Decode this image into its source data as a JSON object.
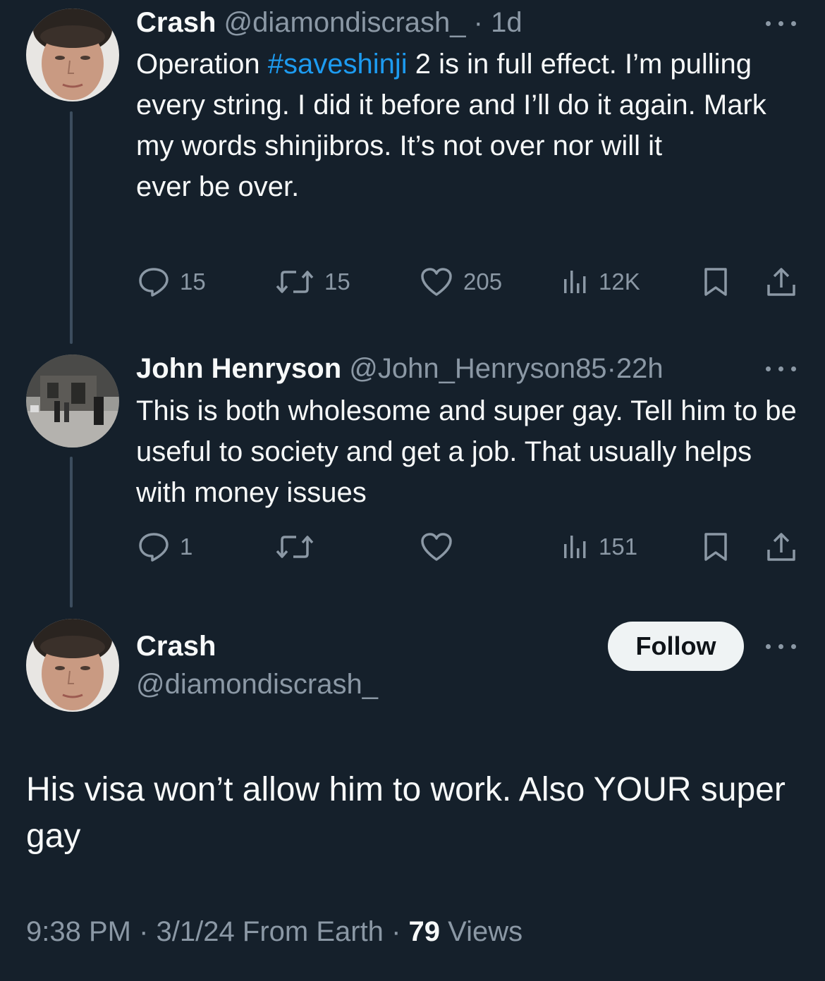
{
  "tweet1": {
    "display_name": "Crash",
    "handle": "@diamondiscrash_",
    "separator": "·",
    "time": "1d",
    "text_before": "Operation ",
    "hashtag": "#saveshinji",
    "text_after": " 2 is in full effect. I’m pulling every string. I did it before and I’ll do it again. Mark my words shinjibros. It’s not over nor will it",
    "text_line2": "ever be over.",
    "replies": "15",
    "retweets": "15",
    "likes": "205",
    "views": "12K"
  },
  "tweet2": {
    "display_name": "John Henryson",
    "handle": "@John_Henryson85",
    "separator": "·",
    "time": "22h",
    "text": "This is both wholesome and super gay. Tell him to be useful to society and get a job. That usually helps with money issues",
    "replies": "1",
    "retweets": "",
    "likes": "",
    "views": "151"
  },
  "main_tweet": {
    "display_name": "Crash",
    "handle": "@diamondiscrash_",
    "follow_label": "Follow",
    "text": "His visa won’t allow him to work. Also YOUR super gay",
    "time": "9:38 PM",
    "separator": "·",
    "date": "3/1/24",
    "location": "From Earth",
    "views_count": "79",
    "views_label": "Views"
  },
  "icons": {
    "reply": "reply-icon",
    "retweet": "retweet-icon",
    "like": "heart-icon",
    "views": "analytics-icon",
    "bookmark": "bookmark-icon",
    "share": "share-icon",
    "more": "more-icon"
  },
  "colors": {
    "background": "#15202b",
    "text": "#f7f9f9",
    "muted": "#8b98a5",
    "link": "#1d9bf0",
    "thread_line": "#3c4d5e",
    "follow_bg": "#eff3f4"
  }
}
